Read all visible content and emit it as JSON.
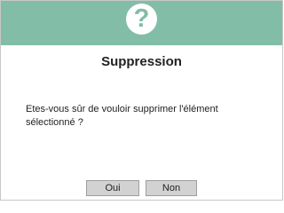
{
  "dialog": {
    "icon": "question-mark-icon",
    "icon_glyph": "?",
    "title": "Suppression",
    "message": "Etes-vous sûr de vouloir supprimer l'élément sélectionné ?",
    "buttons": {
      "yes_label": "Oui",
      "no_label": "Non"
    },
    "colors": {
      "header": "#82bda8",
      "button": "#d2d2d2"
    }
  }
}
